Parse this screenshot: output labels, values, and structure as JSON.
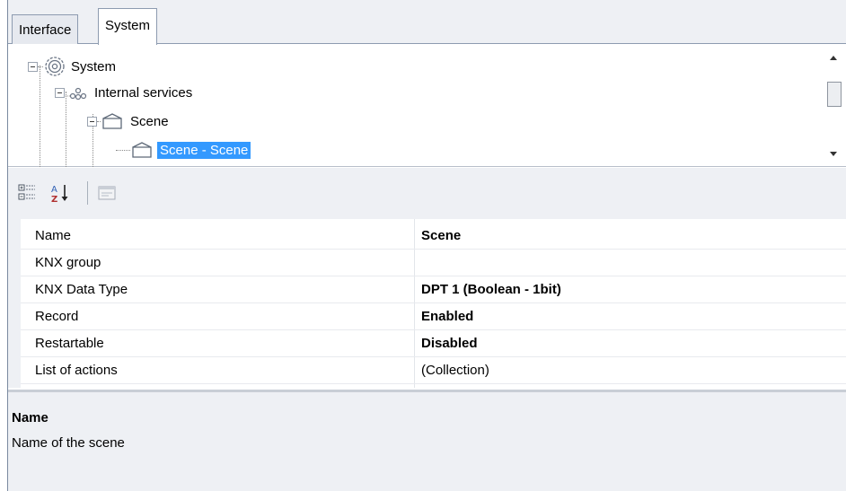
{
  "tabs": [
    {
      "label": "Interface",
      "active": false
    },
    {
      "label": "System",
      "active": true
    }
  ],
  "tree": {
    "nodes": [
      {
        "label": "System",
        "icon": "gear-icon",
        "selected": false
      },
      {
        "label": "Internal services",
        "icon": "services-network-icon",
        "selected": false
      },
      {
        "label": "Scene",
        "icon": "scene-folder-icon",
        "selected": false
      },
      {
        "label": "Scene - Scene",
        "icon": "scene-folder-icon",
        "selected": true
      }
    ]
  },
  "toolbar": {
    "categorized_icon": "categorized-icon",
    "alphabetical_icon": "sort-alphabetical-icon",
    "property_pages_icon": "property-pages-icon"
  },
  "properties": [
    {
      "name": "Name",
      "value": "Scene",
      "bold": true
    },
    {
      "name": "KNX group",
      "value": "",
      "bold": false
    },
    {
      "name": "KNX Data Type",
      "value": "DPT 1 (Boolean - 1bit)",
      "bold": true
    },
    {
      "name": "Record",
      "value": "Enabled",
      "bold": true
    },
    {
      "name": "Restartable",
      "value": "Disabled",
      "bold": true
    },
    {
      "name": "List of actions",
      "value": "(Collection)",
      "bold": false
    }
  ],
  "description": {
    "title": "Name",
    "text": "Name of the scene"
  },
  "colors": {
    "selection": "#3399ff",
    "panel_background": "#eef0f4",
    "border": "#8d9bb0"
  }
}
